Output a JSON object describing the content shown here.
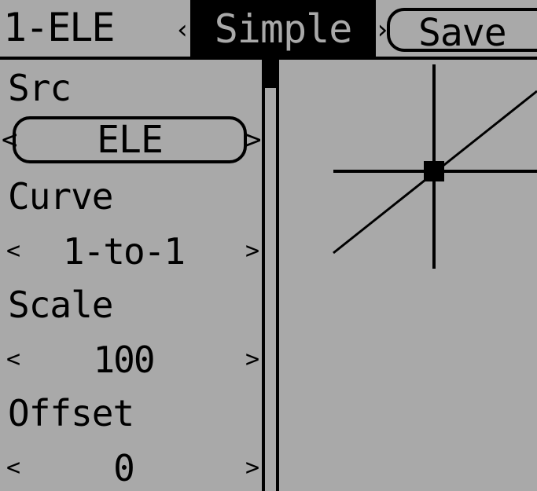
{
  "header": {
    "title": "1-ELE",
    "mode_tab_label": "Simple",
    "save_label": "Save",
    "left_arrow_glyph": "‹",
    "right_arrow_glyph": "›"
  },
  "fields": {
    "src": {
      "label": "Src",
      "value": "ELE"
    },
    "curve": {
      "label": "Curve",
      "value": "1-to-1"
    },
    "scale": {
      "label": "Scale",
      "value": "100"
    },
    "offset": {
      "label": "Offset",
      "value": "0"
    }
  },
  "arrows": {
    "left": "<",
    "right": ">"
  },
  "colors": {
    "background": "#a9a9a9",
    "foreground": "#000000"
  }
}
